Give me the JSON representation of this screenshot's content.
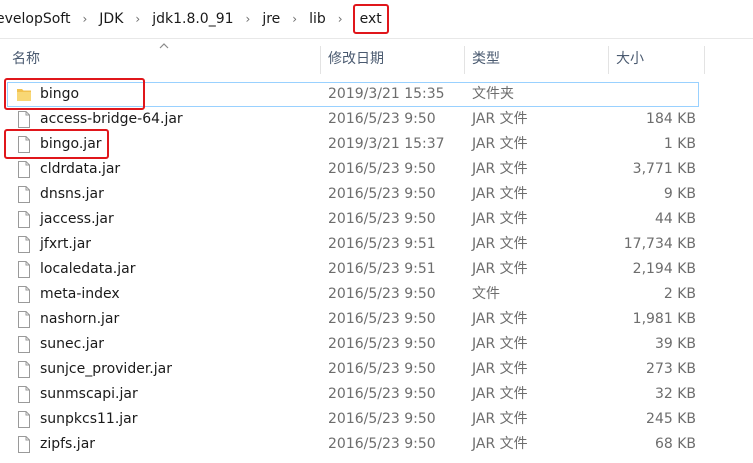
{
  "breadcrumb": {
    "items": [
      "evelopSoft",
      "JDK",
      "jdk1.8.0_91",
      "jre",
      "lib",
      "ext"
    ],
    "separator": "›"
  },
  "columns": {
    "name": "名称",
    "date": "修改日期",
    "type": "类型",
    "size": "大小"
  },
  "files": [
    {
      "name": "bingo",
      "date": "2019/3/21 15:35",
      "type": "文件夹",
      "size": "",
      "icon": "folder-icon"
    },
    {
      "name": "access-bridge-64.jar",
      "date": "2016/5/23 9:50",
      "type": "JAR 文件",
      "size": "184 KB",
      "icon": "file-icon"
    },
    {
      "name": "bingo.jar",
      "date": "2019/3/21 15:37",
      "type": "JAR 文件",
      "size": "1 KB",
      "icon": "file-icon"
    },
    {
      "name": "cldrdata.jar",
      "date": "2016/5/23 9:50",
      "type": "JAR 文件",
      "size": "3,771 KB",
      "icon": "file-icon"
    },
    {
      "name": "dnsns.jar",
      "date": "2016/5/23 9:50",
      "type": "JAR 文件",
      "size": "9 KB",
      "icon": "file-icon"
    },
    {
      "name": "jaccess.jar",
      "date": "2016/5/23 9:50",
      "type": "JAR 文件",
      "size": "44 KB",
      "icon": "file-icon"
    },
    {
      "name": "jfxrt.jar",
      "date": "2016/5/23 9:51",
      "type": "JAR 文件",
      "size": "17,734 KB",
      "icon": "file-icon"
    },
    {
      "name": "localedata.jar",
      "date": "2016/5/23 9:51",
      "type": "JAR 文件",
      "size": "2,194 KB",
      "icon": "file-icon"
    },
    {
      "name": "meta-index",
      "date": "2016/5/23 9:50",
      "type": "文件",
      "size": "2 KB",
      "icon": "file-icon"
    },
    {
      "name": "nashorn.jar",
      "date": "2016/5/23 9:50",
      "type": "JAR 文件",
      "size": "1,981 KB",
      "icon": "file-icon"
    },
    {
      "name": "sunec.jar",
      "date": "2016/5/23 9:50",
      "type": "JAR 文件",
      "size": "39 KB",
      "icon": "file-icon"
    },
    {
      "name": "sunjce_provider.jar",
      "date": "2016/5/23 9:50",
      "type": "JAR 文件",
      "size": "273 KB",
      "icon": "file-icon"
    },
    {
      "name": "sunmscapi.jar",
      "date": "2016/5/23 9:50",
      "type": "JAR 文件",
      "size": "32 KB",
      "icon": "file-icon"
    },
    {
      "name": "sunpkcs11.jar",
      "date": "2016/5/23 9:50",
      "type": "JAR 文件",
      "size": "245 KB",
      "icon": "file-icon"
    },
    {
      "name": "zipfs.jar",
      "date": "2016/5/23 9:50",
      "type": "JAR 文件",
      "size": "68 KB",
      "icon": "file-icon"
    }
  ],
  "colors": {
    "highlight": "#e0161b",
    "selection_border": "#99d1ff",
    "folder": "#f2c14e",
    "header_text": "#4a5a70",
    "secondary_text": "#6d6d6d"
  }
}
